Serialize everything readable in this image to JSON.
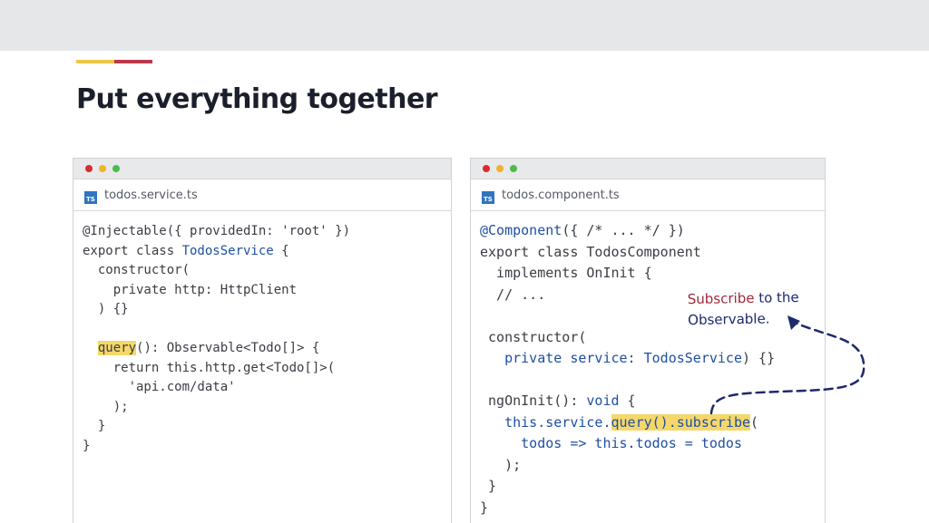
{
  "slide": {
    "title": "Put everything together",
    "accent_colors": {
      "yellow": "#f2c44d",
      "red": "#b83a4b"
    }
  },
  "window_dots": [
    "#d62d2d",
    "#f0b429",
    "#4cbb4a"
  ],
  "left_window": {
    "icon": "ts-file-icon",
    "icon_text": "TS",
    "file_name": "todos.service.ts"
  },
  "right_window": {
    "icon": "ts-file-icon",
    "icon_text": "TS",
    "file_name": "todos.component.ts"
  },
  "left_code": {
    "l1": "@Injectable({ providedIn: 'root' })",
    "l2a": "export class ",
    "l2b": "TodosService",
    "l2c": " {",
    "l3": "  constructor(",
    "l4": "    private http: HttpClient",
    "l5": "  ) {}",
    "l6a": "  ",
    "l6b": "query",
    "l6c": "(): Observable<Todo[]> {",
    "l7": "    return this.http.get<Todo[]>(",
    "l8": "      'api.com/data'",
    "l9": "    );",
    "l10": "  }",
    "l11": "}"
  },
  "right_code": {
    "l1a": "@Component",
    "l1b": "({ /* ... */ })",
    "l2": "export class TodosComponent",
    "l3": "  implements OnInit {",
    "l4": "  // ...",
    "l5": " constructor(",
    "l6a": "   ",
    "l6b": "private service: ",
    "l6c": "TodosService",
    "l6d": ") {}",
    "l7a": " ngOnInit",
    "l7b": "(): ",
    "l7c": "void",
    "l7d": " {",
    "l8a": "   ",
    "l8b": "this.service.",
    "l8c": "query().subscribe",
    "l8d": "(",
    "l9a": "     ",
    "l9b": "todos => this.",
    "l9c": "todos = todos",
    "l10": "   );",
    "l11": " }",
    "l12": "}"
  },
  "annotation": {
    "word1": "Subscribe",
    "rest1": " to the",
    "line2": "Observable."
  }
}
